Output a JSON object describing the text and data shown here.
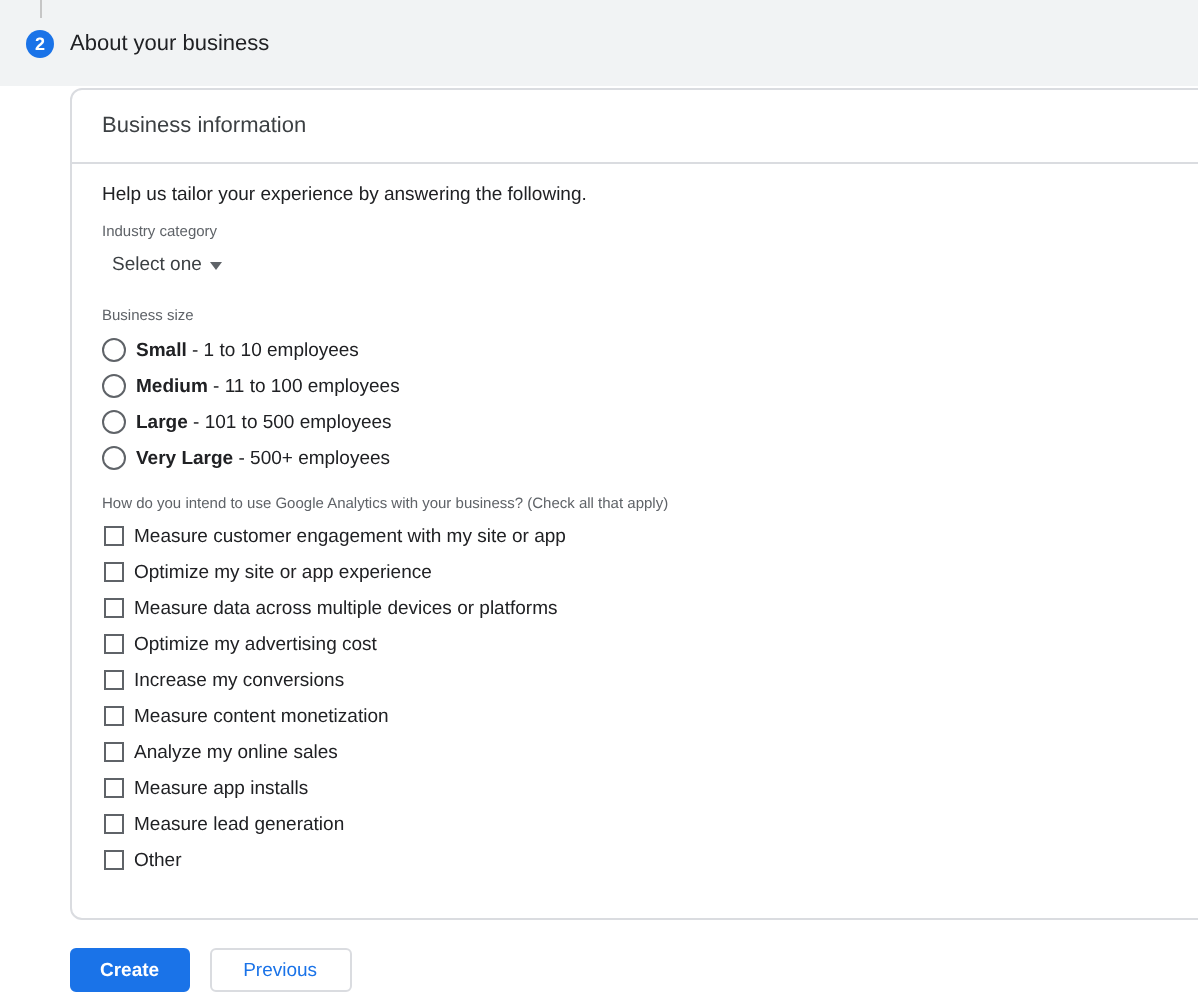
{
  "step": {
    "number": "2",
    "title": "About your business"
  },
  "card": {
    "title": "Business information",
    "intro": "Help us tailor your experience by answering the following.",
    "industry": {
      "label": "Industry category",
      "value": "Select one"
    },
    "size": {
      "label": "Business size",
      "options": [
        {
          "text": "**Small** - 1 to 10 employees",
          "selected": false
        },
        {
          "text": "**Medium** - 11 to 100 employees",
          "selected": false
        },
        {
          "text": "**Large** - 101 to 500 employees",
          "selected": false
        },
        {
          "text": "**Very Large** - 500+ employees",
          "selected": false
        }
      ]
    },
    "usage": {
      "label": "How do you intend to use Google Analytics with your business? (Check all that apply)",
      "options": [
        {
          "text": "Measure customer engagement with my site or app",
          "checked": false
        },
        {
          "text": "Optimize my site or app experience",
          "checked": false
        },
        {
          "text": "Measure data across multiple devices or platforms",
          "checked": false
        },
        {
          "text": "Optimize my advertising cost",
          "checked": false
        },
        {
          "text": "Increase my conversions",
          "checked": false
        },
        {
          "text": "Measure content monetization",
          "checked": false
        },
        {
          "text": "Analyze my online sales",
          "checked": false
        },
        {
          "text": "Measure app installs",
          "checked": false
        },
        {
          "text": "Measure lead generation",
          "checked": false
        },
        {
          "text": "Other",
          "checked": false
        }
      ]
    }
  },
  "buttons": [
    {
      "label": "Create",
      "kind": "primary"
    },
    {
      "label": "Previous",
      "kind": "secondary"
    }
  ]
}
